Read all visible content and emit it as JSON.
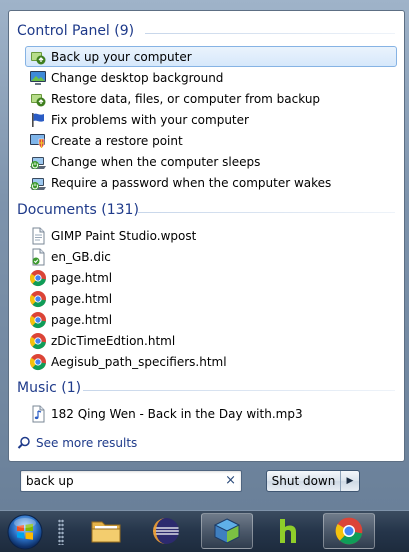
{
  "start_menu": {
    "groups": [
      {
        "title": "Control Panel (9)",
        "items": [
          {
            "label": "Back up your computer",
            "icon": "backup-icon",
            "selected": true
          },
          {
            "label": "Change desktop background",
            "icon": "monitor-icon"
          },
          {
            "label": "Restore data, files, or computer from backup",
            "icon": "backup-icon"
          },
          {
            "label": "Fix problems with your computer",
            "icon": "flag-icon"
          },
          {
            "label": "Create a restore point",
            "icon": "shield-monitor-icon"
          },
          {
            "label": "Change when the computer sleeps",
            "icon": "power-options-icon"
          },
          {
            "label": "Require a password when the computer wakes",
            "icon": "power-options-icon"
          }
        ]
      },
      {
        "title": "Documents (131)",
        "items": [
          {
            "label": "GIMP Paint Studio.wpost",
            "icon": "document-icon"
          },
          {
            "label": "en_GB.dic",
            "icon": "dictionary-file-icon"
          },
          {
            "label": "page.html",
            "icon": "chrome-icon"
          },
          {
            "label": "page.html",
            "icon": "chrome-icon"
          },
          {
            "label": "page.html",
            "icon": "chrome-icon"
          },
          {
            "label": "zDicTimeEdtion.html",
            "icon": "chrome-icon"
          },
          {
            "label": "Aegisub_path_specifiers.html",
            "icon": "chrome-icon"
          }
        ]
      },
      {
        "title": "Music (1)",
        "items": [
          {
            "label": "182 Qing Wen - Back in the Day with.mp3",
            "icon": "music-note-icon"
          }
        ]
      }
    ],
    "see_more": "See more results",
    "search": {
      "value": "back up",
      "clear": "×"
    },
    "shutdown": {
      "label": "Shut down",
      "arrow": "▶"
    }
  },
  "taskbar": {
    "buttons": [
      {
        "name": "start-button",
        "icon": "windows-orb-icon"
      },
      {
        "name": "explorer-button",
        "icon": "folder-icon"
      },
      {
        "name": "eclipse-button",
        "icon": "eclipse-icon"
      },
      {
        "name": "virtualbox-button",
        "icon": "virtualbox-icon",
        "running": true
      },
      {
        "name": "hulu-button",
        "icon": "hulu-icon"
      },
      {
        "name": "chrome-button",
        "icon": "chrome-icon",
        "running": true
      }
    ]
  },
  "colors": {
    "header_text": "#1e3a8a",
    "selection_fill": "#d6e8fb",
    "selection_border": "#86b3e4"
  }
}
